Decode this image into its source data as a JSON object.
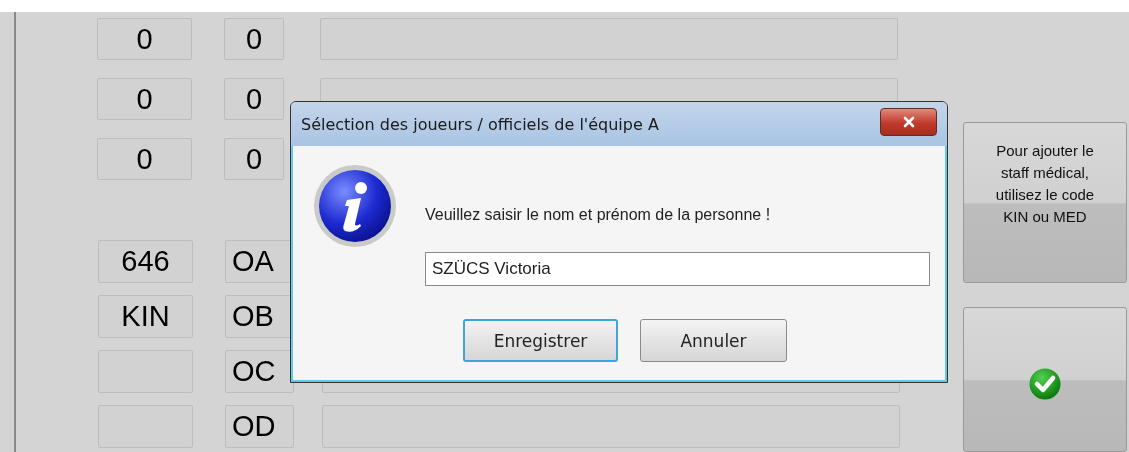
{
  "player_rows": [
    {
      "number": "0",
      "code": "0"
    },
    {
      "number": "0",
      "code": "0"
    },
    {
      "number": "0",
      "code": "0",
      "name_field": false
    }
  ],
  "official_rows": [
    {
      "number": "646",
      "code": "OA",
      "name_field": false
    },
    {
      "number": "KIN",
      "code": "OB",
      "name_field": false
    },
    {
      "code": "OC"
    },
    {
      "code": "OD"
    }
  ],
  "side_buttons": [
    {
      "kind": "text",
      "label": "Pour ajouter le staff médical, utilisez le code KIN ou MED"
    },
    {
      "kind": "confirm"
    }
  ],
  "dialog": {
    "title": "Sélection des joueurs / officiels de l'équipe A",
    "message": "Veuillez saisir le nom et prénom de la personne !",
    "input": {
      "value": "SZÜCS Victoria",
      "focused": true
    },
    "buttons": [
      {
        "label": "Enregistrer",
        "default": true
      },
      {
        "label": "Annuler",
        "default": false
      }
    ]
  }
}
